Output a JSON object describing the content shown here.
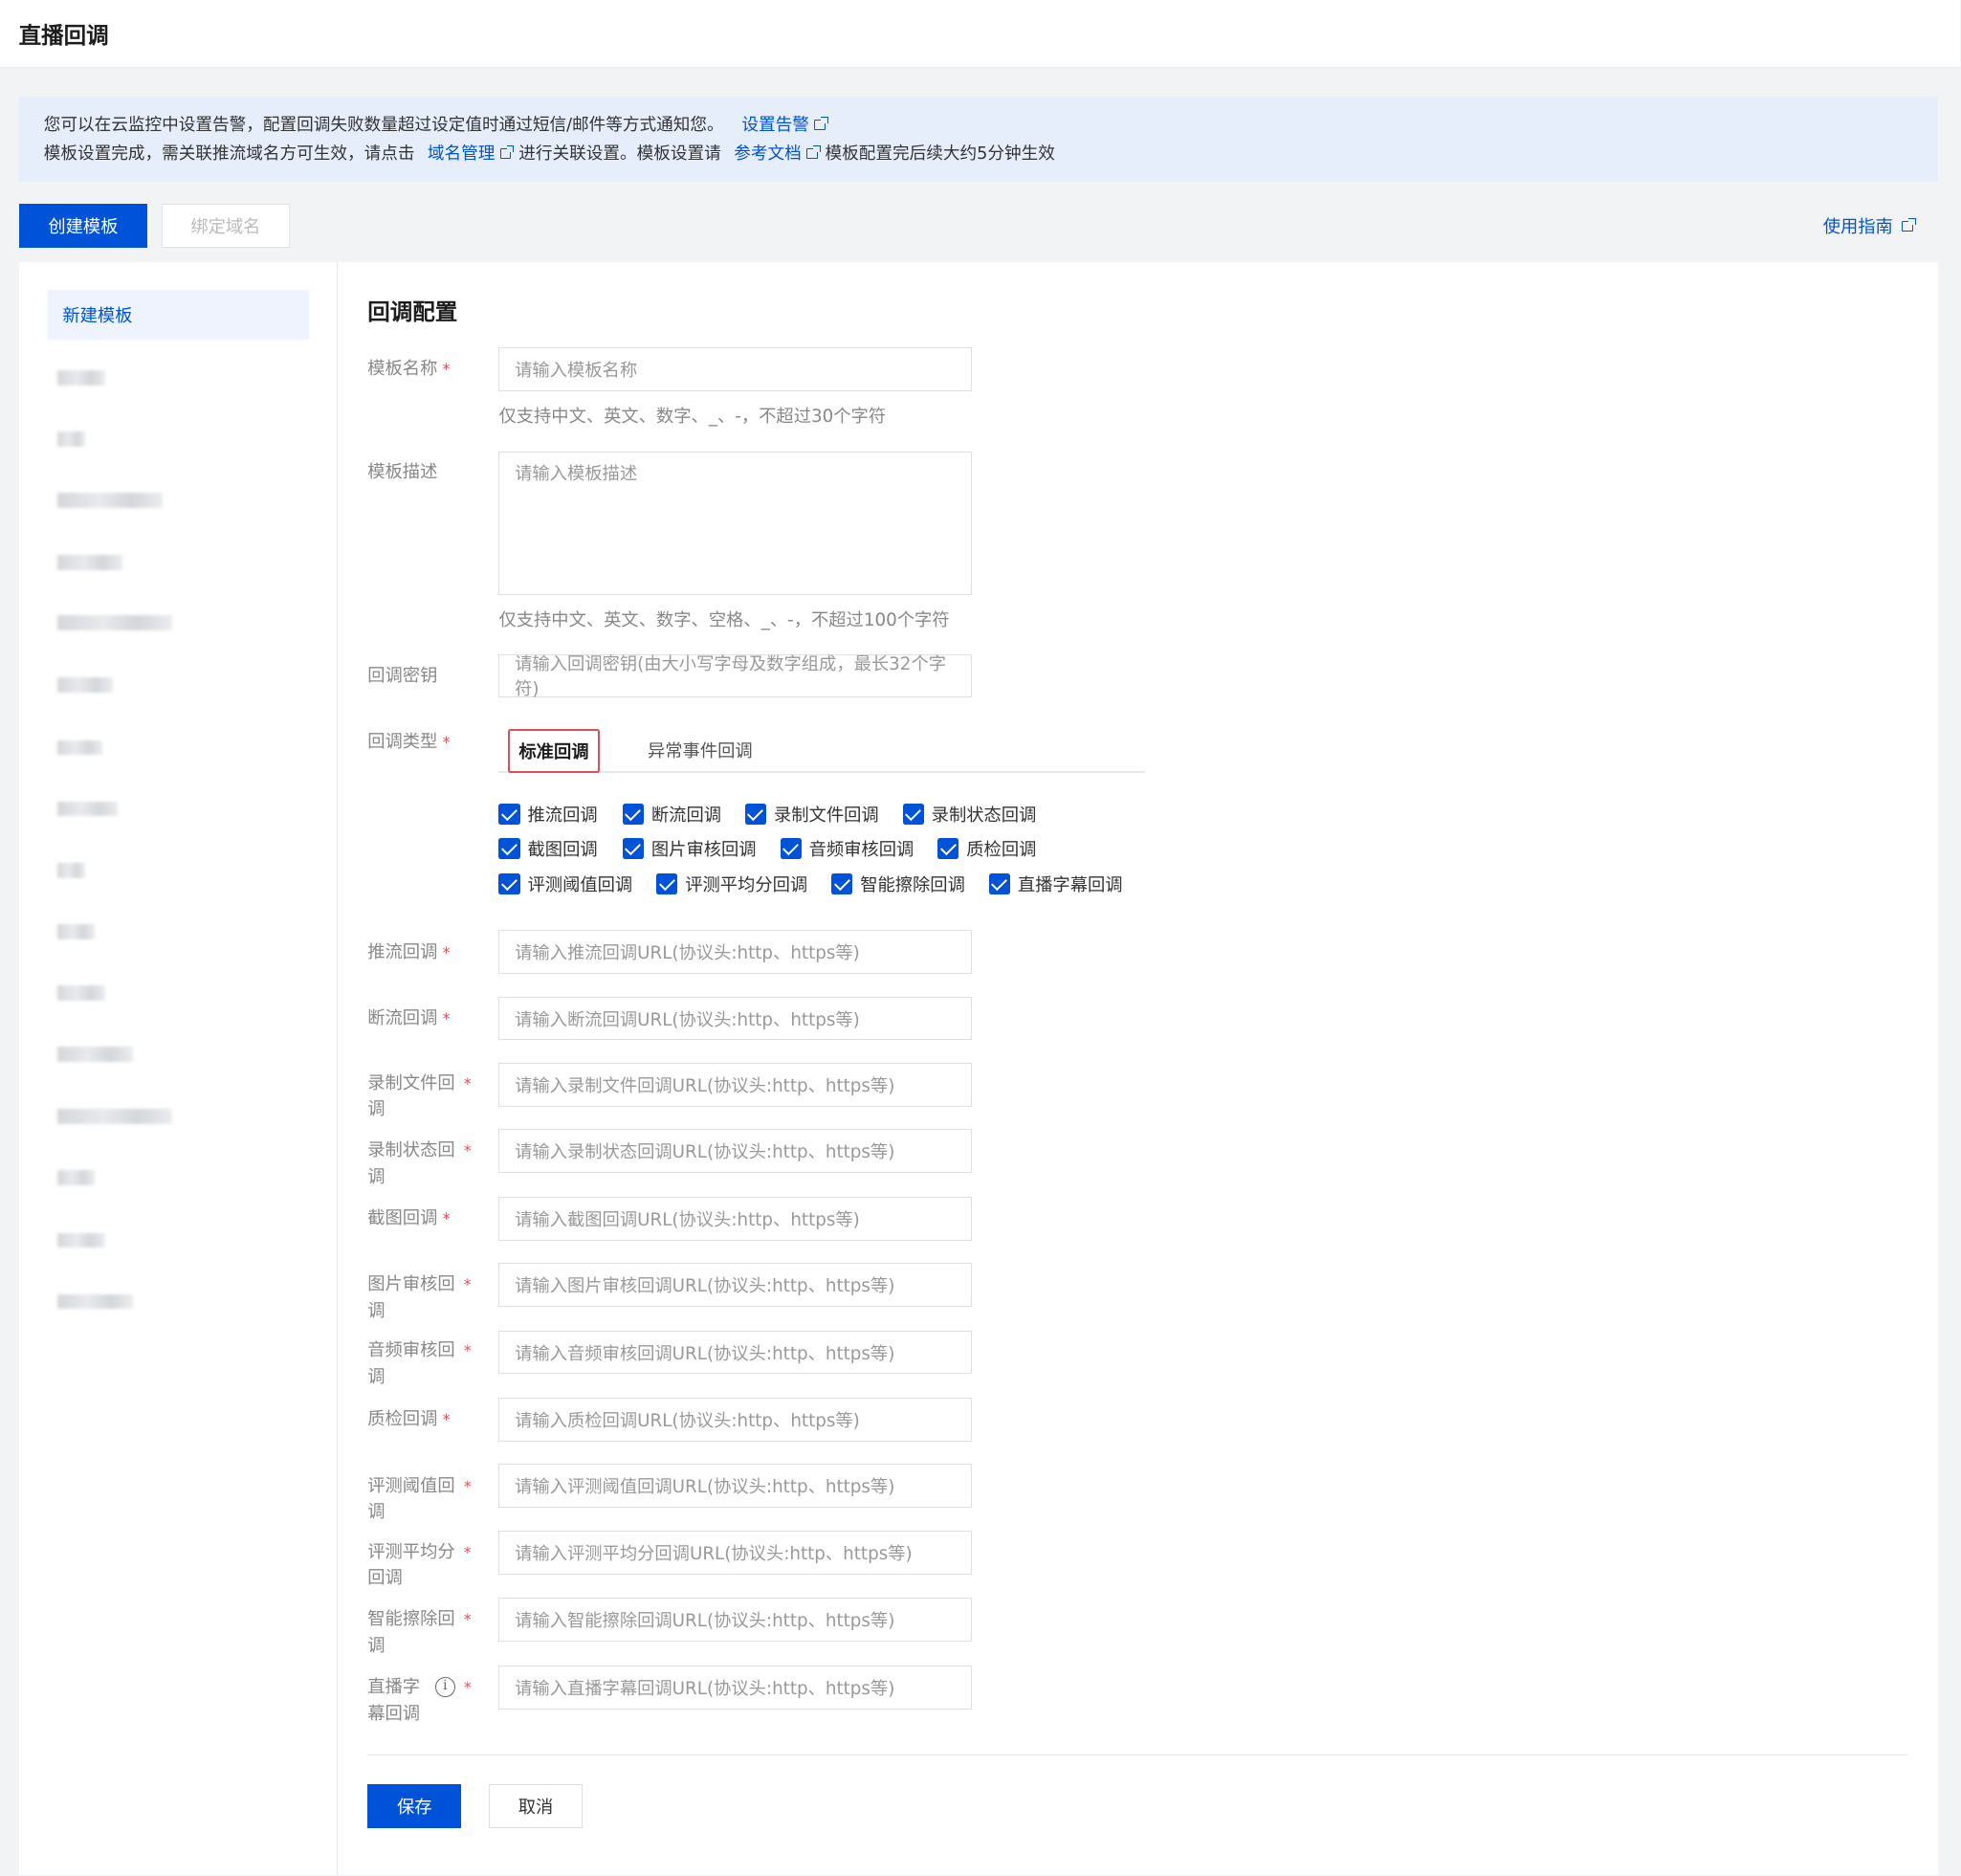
{
  "header": {
    "title": "直播回调"
  },
  "notice": {
    "line1_text": "您可以在云监控中设置告警，配置回调失败数量超过设定值时通过短信/邮件等方式通知您。",
    "line1_link": "设置告警",
    "line2_part1": "模板设置完成，需关联推流域名方可生效，请点击",
    "line2_link1": "域名管理",
    "line2_part2": "进行关联设置。模板设置请",
    "line2_link2": "参考文档",
    "line2_part3": "模板配置完后续大约5分钟生效"
  },
  "toolbar": {
    "create_label": "创建模板",
    "bind_label": "绑定域名",
    "guide_label": "使用指南"
  },
  "sidebar": {
    "active_label": "新建模板"
  },
  "form": {
    "title": "回调配置",
    "name_label": "模板名称",
    "name_placeholder": "请输入模板名称",
    "name_hint": "仅支持中文、英文、数字、_、-，不超过30个字符",
    "desc_label": "模板描述",
    "desc_placeholder": "请输入模板描述",
    "desc_hint": "仅支持中文、英文、数字、空格、_、-，不超过100个字符",
    "secret_label": "回调密钥",
    "secret_placeholder": "请输入回调密钥(由大小写字母及数字组成，最长32个字符)",
    "type_label": "回调类型",
    "tab_standard": "标准回调",
    "tab_abnormal": "异常事件回调",
    "checkboxes": [
      "推流回调",
      "断流回调",
      "录制文件回调",
      "录制状态回调",
      "截图回调",
      "图片审核回调",
      "音频审核回调",
      "质检回调",
      "评测阈值回调",
      "评测平均分回调",
      "智能擦除回调",
      "直播字幕回调"
    ],
    "fields": [
      {
        "label": "推流回调",
        "placeholder": "请输入推流回调URL(协议头:http、https等)"
      },
      {
        "label": "断流回调",
        "placeholder": "请输入断流回调URL(协议头:http、https等)"
      },
      {
        "label": "录制文件回调",
        "placeholder": "请输入录制文件回调URL(协议头:http、https等)"
      },
      {
        "label": "录制状态回调",
        "placeholder": "请输入录制状态回调URL(协议头:http、https等)"
      },
      {
        "label": "截图回调",
        "placeholder": "请输入截图回调URL(协议头:http、https等)"
      },
      {
        "label": "图片审核回调",
        "placeholder": "请输入图片审核回调URL(协议头:http、https等)"
      },
      {
        "label": "音频审核回调",
        "placeholder": "请输入音频审核回调URL(协议头:http、https等)"
      },
      {
        "label": "质检回调",
        "placeholder": "请输入质检回调URL(协议头:http、https等)"
      },
      {
        "label": "评测阈值回调",
        "placeholder": "请输入评测阈值回调URL(协议头:http、https等)"
      },
      {
        "label": "评测平均分回调",
        "placeholder": "请输入评测平均分回调URL(协议头:http、https等)"
      },
      {
        "label": "智能擦除回调",
        "placeholder": "请输入智能擦除回调URL(协议头:http、https等)"
      },
      {
        "label": "直播字幕回调",
        "placeholder": "请输入直播字幕回调URL(协议头:http、https等)"
      }
    ],
    "save_label": "保存",
    "cancel_label": "取消"
  }
}
